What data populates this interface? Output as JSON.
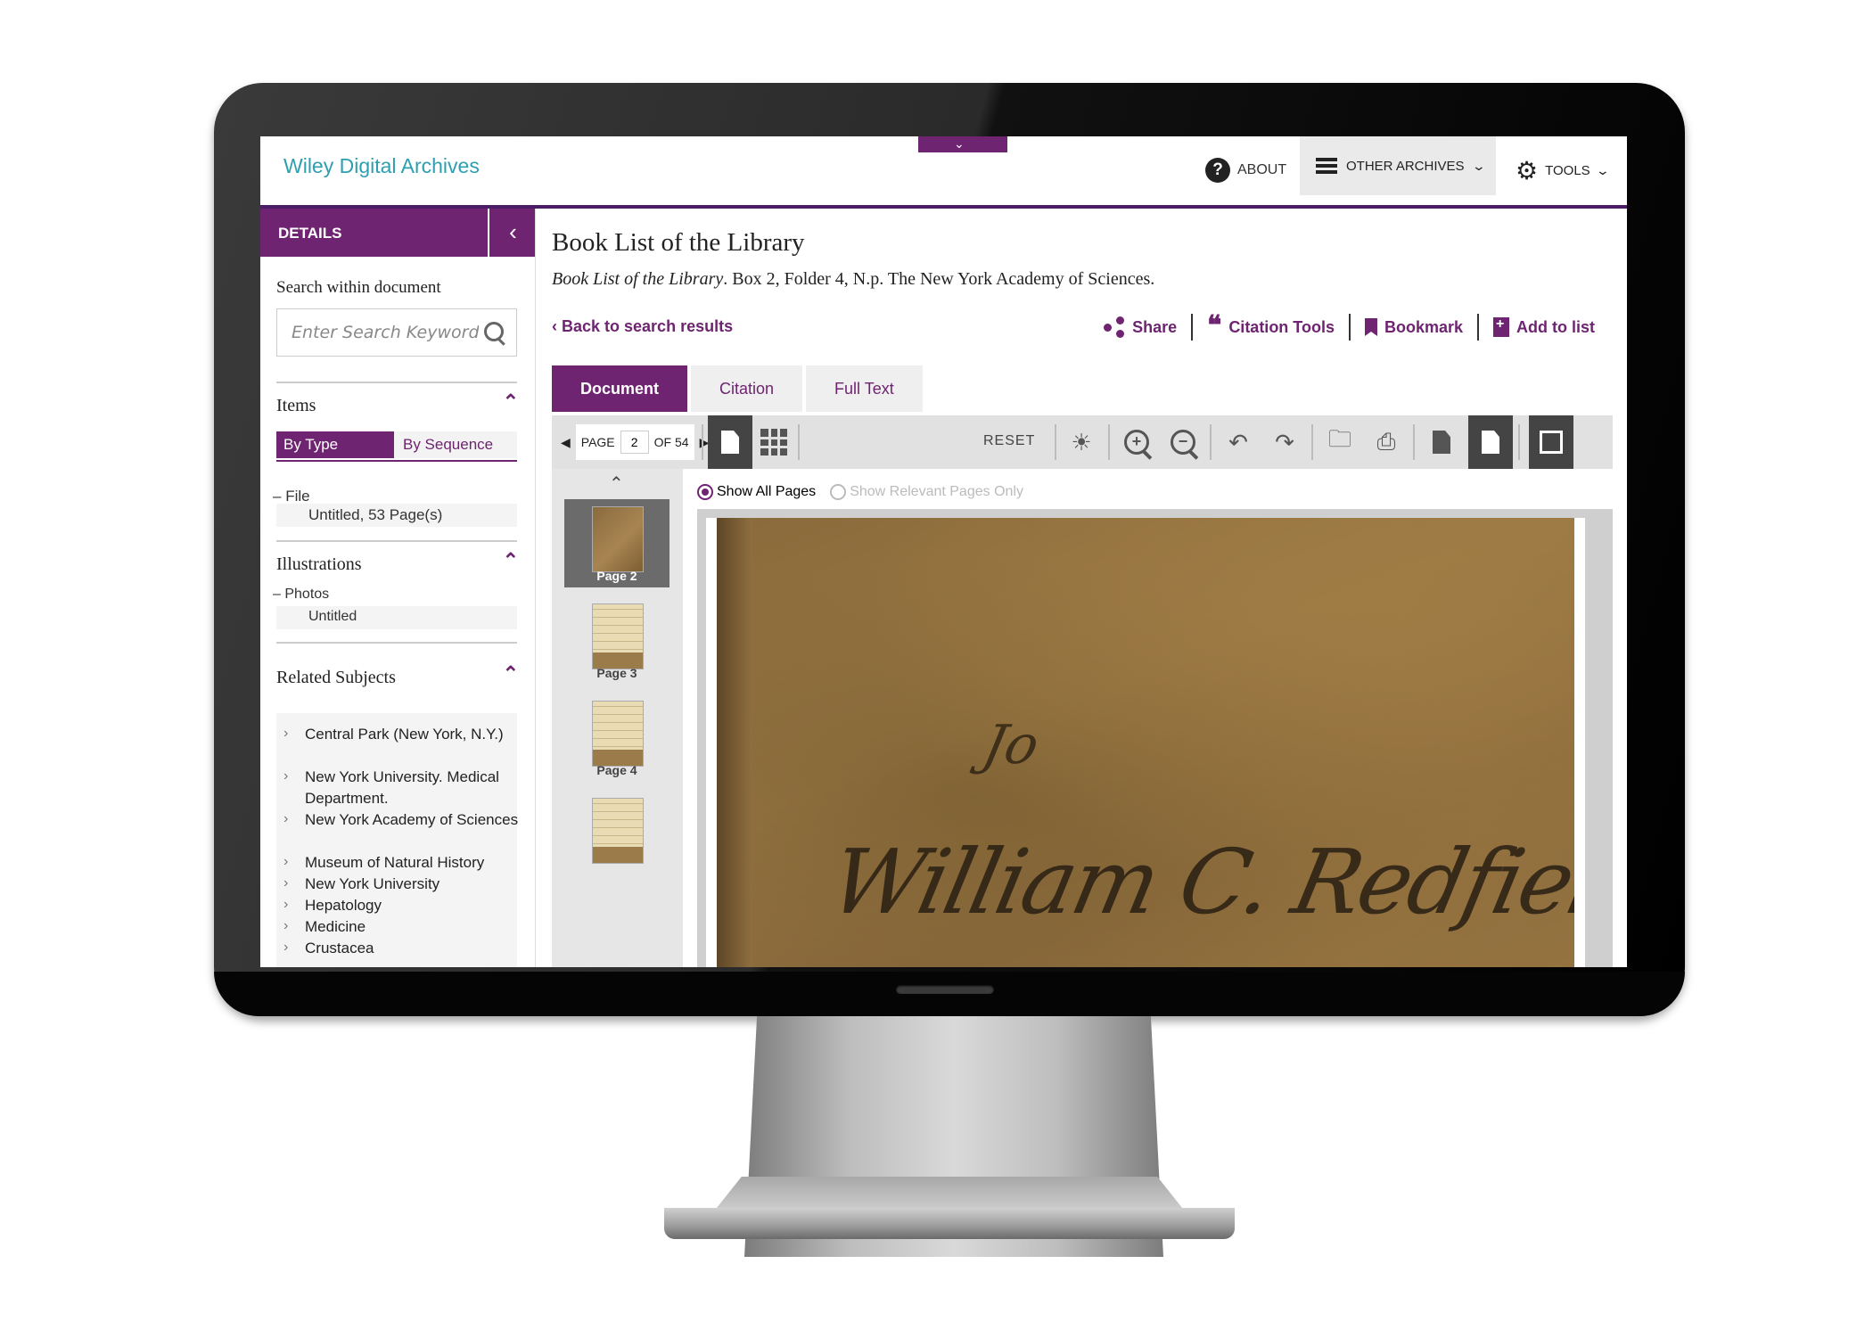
{
  "app": {
    "title": "Wiley Digital Archives"
  },
  "nav": {
    "about": "ABOUT",
    "other_archives": "OTHER ARCHIVES",
    "tools": "TOOLS"
  },
  "sidebar": {
    "header": "DETAILS",
    "search_label": "Search within document",
    "search_placeholder": "Enter Search Keyword",
    "items_heading": "Items",
    "by_type": "By Type",
    "by_sequence": "By Sequence",
    "file_label": "File",
    "file_item": "Untitled, 53 Page(s)",
    "illustrations_heading": "Illustrations",
    "photos_label": "Photos",
    "photos_item": "Untitled",
    "related_heading": "Related Subjects",
    "subjects": [
      "Central Park (New York, N.Y.)",
      "New York University. Medical Department.",
      "New York Academy of Sciences",
      "Museum of Natural History",
      "New York University",
      "Hepatology",
      "Medicine",
      "Crustacea"
    ]
  },
  "document": {
    "title": "Book List of the Library",
    "citation_italic": "Book List of the Library",
    "citation_rest": ". Box 2, Folder 4, N.p. The New York Academy of Sciences.",
    "back_link": "Back to search results",
    "actions": {
      "share": "Share",
      "citation_tools": "Citation Tools",
      "bookmark": "Bookmark",
      "add_to_list": "Add to list"
    },
    "tabs": [
      "Document",
      "Citation",
      "Full Text"
    ],
    "active_tab": "Document"
  },
  "viewer": {
    "page_label": "PAGE",
    "current_page": "2",
    "of_label": "OF 54",
    "reset": "RESET",
    "show_all": "Show All Pages",
    "show_relevant": "Show Relevant Pages Only",
    "thumbnails": [
      "Page 2",
      "Page 3",
      "Page 4"
    ],
    "selected_thumbnail": "Page 2",
    "handwriting_top": "Jo",
    "handwriting_main": "William C. Redfield Esq."
  },
  "colors": {
    "brand_purple": "#6e2470",
    "title_teal": "#2e9fb0",
    "toolbar_gray": "#e1e1e1"
  }
}
